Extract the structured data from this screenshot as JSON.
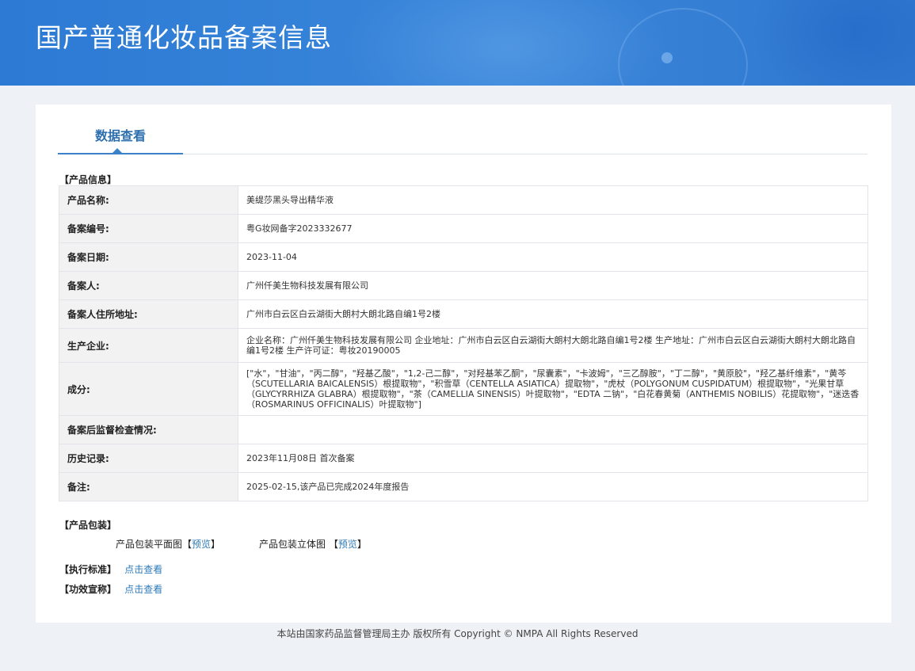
{
  "header": {
    "title": "国产普通化妆品备案信息"
  },
  "tab": {
    "label": "数据查看"
  },
  "product_info": {
    "section_title": "【产品信息】",
    "rows": [
      {
        "label": "产品名称:",
        "value": "美缇莎黑头导出精华液"
      },
      {
        "label": "备案编号:",
        "value": "粤G妆网备字2023332677"
      },
      {
        "label": "备案日期:",
        "value": "2023-11-04"
      },
      {
        "label": "备案人:",
        "value": "广州仟美生物科技发展有限公司"
      },
      {
        "label": "备案人住所地址:",
        "value": "广州市白云区白云湖街大朗村大朗北路自编1号2楼"
      },
      {
        "label": "生产企业:",
        "value": "企业名称：广州仟美生物科技发展有限公司 企业地址：广州市白云区白云湖街大朗村大朗北路自编1号2楼 生产地址：广州市白云区白云湖街大朗村大朗北路自编1号2楼 生产许可证：粤妆20190005"
      },
      {
        "label": "成分:",
        "value": "[\"水\"，\"甘油\"，\"丙二醇\"，\"羟基乙酸\"，\"1,2-己二醇\"，\"对羟基苯乙酮\"，\"尿囊素\"，\"卡波姆\"，\"三乙醇胺\"，\"丁二醇\"，\"黄原胶\"，\"羟乙基纤维素\"，\"黄芩（SCUTELLARIA BAICALENSIS）根提取物\"，\"积雪草（CENTELLA ASIATICA）提取物\"，\"虎杖（POLYGONUM CUSPIDATUM）根提取物\"，\"光果甘草（GLYCYRRHIZA GLABRA）根提取物\"，\"茶（CAMELLIA SINENSIS）叶提取物\"，\"EDTA 二钠\"，\"白花春黄菊（ANTHEMIS NOBILIS）花提取物\"，\"迷迭香（ROSMARINUS OFFICINALIS）叶提取物\"]"
      },
      {
        "label": "备案后监督检查情况:",
        "value": ""
      },
      {
        "label": "历史记录:",
        "value": "2023年11月08日 首次备案"
      },
      {
        "label": "备注:",
        "value": "2025-02-15,该产品已完成2024年度报告"
      }
    ]
  },
  "packaging": {
    "section_title": "【产品包装】",
    "flat_label": "产品包装平面图",
    "stereo_label": "产品包装立体图",
    "preview_text": "预览",
    "bracket_open": "【",
    "bracket_close": "】"
  },
  "standard": {
    "section_title": "【执行标准】",
    "link_text": "点击查看"
  },
  "efficacy": {
    "section_title": "【功效宣称】",
    "link_text": "点击查看"
  },
  "footer": {
    "text": "本站由国家药品监督管理局主办 版权所有 Copyright © NMPA All Rights Reserved"
  }
}
